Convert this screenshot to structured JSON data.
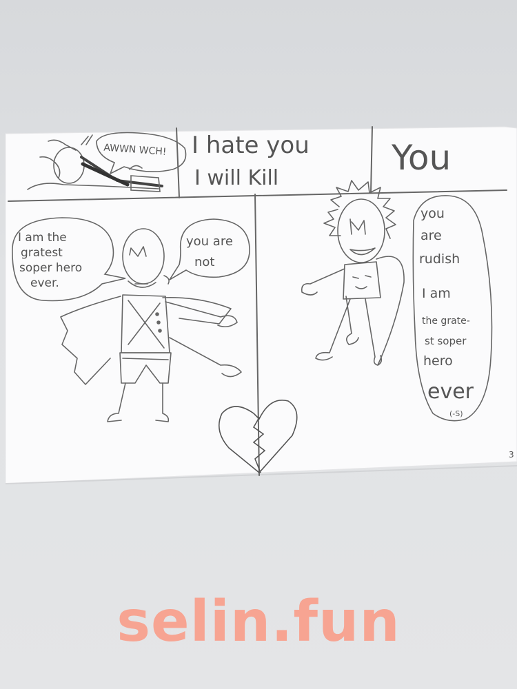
{
  "panel1": {
    "speech": "AWWN WCH!"
  },
  "panel2": {
    "line1": "I hate you",
    "line2": "I will Kill"
  },
  "panel3": {
    "text": "You"
  },
  "panel4": {
    "left_speech": [
      "I am the",
      "gratest",
      "soper hero",
      "ever."
    ],
    "right_speech": [
      "you are",
      "not"
    ],
    "chest_letter": "M"
  },
  "panel5": {
    "speech": [
      "you",
      "are",
      "rudish",
      "I am",
      "the grate-",
      "st soper",
      "hero",
      "ever"
    ],
    "speech_end": "(-S)"
  },
  "page_number": "3",
  "watermark": "selin.fun"
}
